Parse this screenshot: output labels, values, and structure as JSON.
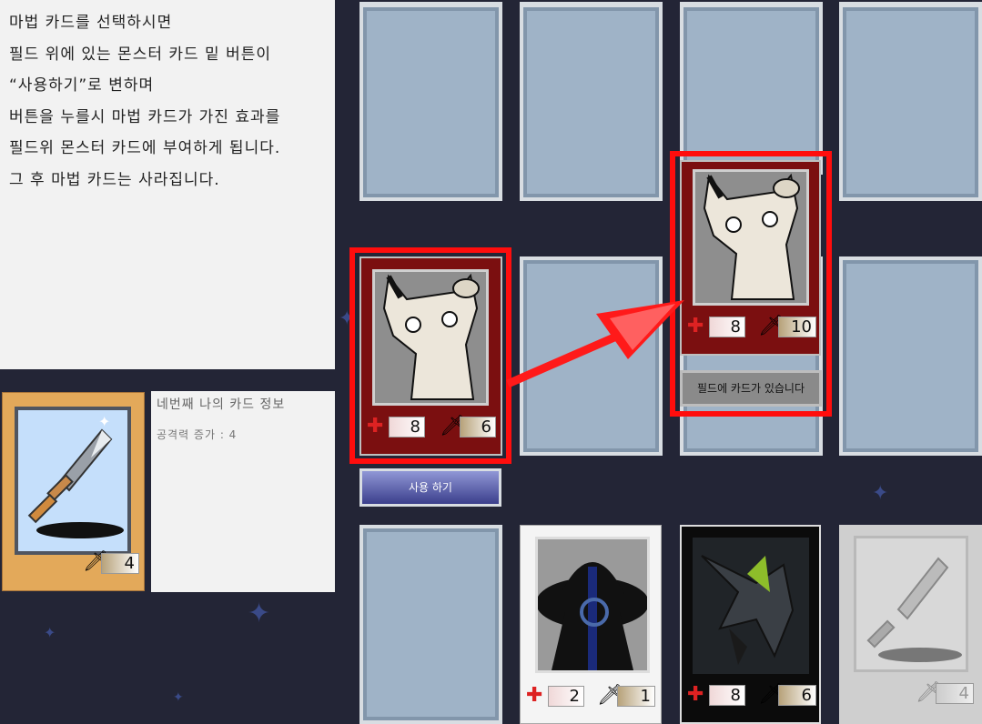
{
  "tutorial": {
    "lines": [
      "마법 카드를 선택하시면",
      "필드 위에 있는 몬스터 카드 밑 버튼이",
      "“사용하기”로 변하며",
      "버튼을 누를시 마법 카드가 가진 효과를",
      "필드위 몬스터 카드에 부여하게 됩니다.",
      "그 후 마법 카드는 사라집니다."
    ]
  },
  "selected_card": {
    "title": "네번째 나의 카드 정보",
    "effect": "공격력 증가 : 4",
    "attack": "4",
    "icon": "sword-icon"
  },
  "field": {
    "left_monster": {
      "hp": "8",
      "atk": "6",
      "icon": "cat-monster-art"
    },
    "right_monster": {
      "hp": "8",
      "atk": "10",
      "icon": "cat-monster-art"
    },
    "use_button": "사용 하기",
    "occupied_button": "필드에 카드가 있습니다"
  },
  "hand": [
    {
      "hp": "2",
      "atk": "1",
      "icon": "hooded-figure-art"
    },
    {
      "hp": "8",
      "atk": "6",
      "icon": "dark-dragon-art"
    },
    {
      "atk": "4",
      "icon": "sword-icon"
    }
  ],
  "colors": {
    "highlight": "#ff0d0d",
    "monster_card_bg": "#7b0f10",
    "slot_bg": "#9fb3c7"
  }
}
